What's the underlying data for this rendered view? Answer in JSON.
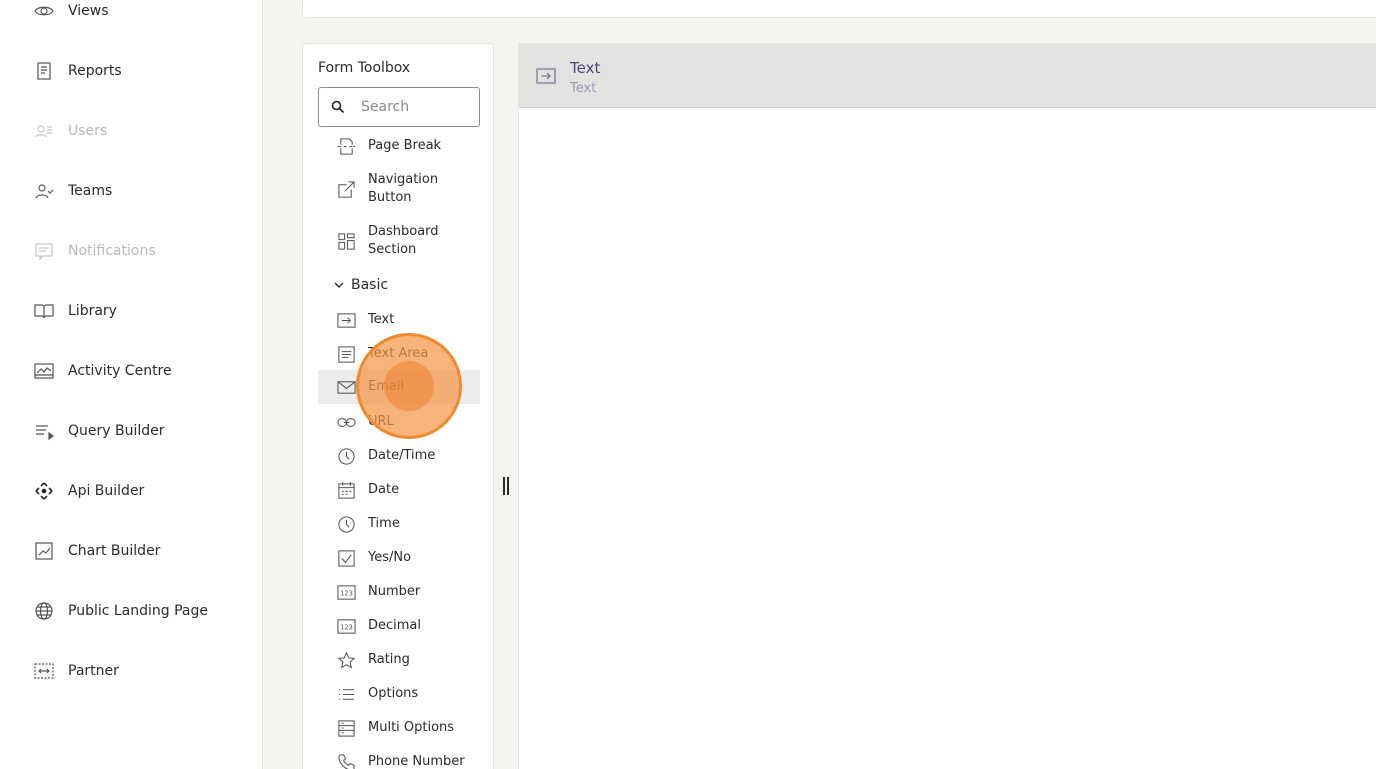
{
  "sidebar": {
    "items": [
      {
        "label": "Views",
        "icon": "eye-icon",
        "disabled": false
      },
      {
        "label": "Reports",
        "icon": "report-icon",
        "disabled": false
      },
      {
        "label": "Users",
        "icon": "users-icon",
        "disabled": true
      },
      {
        "label": "Teams",
        "icon": "teams-icon",
        "disabled": false
      },
      {
        "label": "Notifications",
        "icon": "message-icon",
        "disabled": true
      },
      {
        "label": "Library",
        "icon": "book-icon",
        "disabled": false
      },
      {
        "label": "Activity Centre",
        "icon": "activity-icon",
        "disabled": false
      },
      {
        "label": "Query Builder",
        "icon": "query-icon",
        "disabled": false
      },
      {
        "label": "Api Builder",
        "icon": "api-icon",
        "disabled": false
      },
      {
        "label": "Chart Builder",
        "icon": "chart-icon",
        "disabled": false
      },
      {
        "label": "Public Landing Page",
        "icon": "globe-icon",
        "disabled": false
      },
      {
        "label": "Partner",
        "icon": "partner-icon",
        "disabled": false
      }
    ]
  },
  "toolbox": {
    "title": "Form Toolbox",
    "search_placeholder": "Search",
    "items_top": [
      {
        "label": "Page Break",
        "icon": "page-break-icon"
      },
      {
        "label": "Navigation Button",
        "icon": "navigation-icon"
      },
      {
        "label": "Dashboard Section",
        "icon": "dashboard-icon"
      }
    ],
    "group": {
      "label": "Basic",
      "icon": "chevron-down-icon"
    },
    "items_basic": [
      {
        "label": "Text",
        "icon": "text-input-icon"
      },
      {
        "label": "Text Area",
        "icon": "text-area-icon"
      },
      {
        "label": "Email",
        "icon": "envelope-icon"
      },
      {
        "label": "URL",
        "icon": "link-icon"
      },
      {
        "label": "Date/Time",
        "icon": "clock-icon"
      },
      {
        "label": "Date",
        "icon": "calendar-icon"
      },
      {
        "label": "Time",
        "icon": "clock-icon"
      },
      {
        "label": "Yes/No",
        "icon": "checkbox-icon"
      },
      {
        "label": "Number",
        "icon": "number-icon"
      },
      {
        "label": "Decimal",
        "icon": "decimal-icon"
      },
      {
        "label": "Rating",
        "icon": "star-icon"
      },
      {
        "label": "Options",
        "icon": "list-icon"
      },
      {
        "label": "Multi Options",
        "icon": "multi-options-icon"
      },
      {
        "label": "Phone Number",
        "icon": "phone-icon"
      }
    ]
  },
  "canvas": {
    "field": {
      "title": "Text",
      "subtitle": "Text",
      "icon": "text-input-icon"
    }
  },
  "colors": {
    "accent_marker": "#f08a2c",
    "field_title": "#4a4a7a",
    "field_subtitle": "#9a9ac0",
    "disabled_text": "#b9b9b9"
  }
}
